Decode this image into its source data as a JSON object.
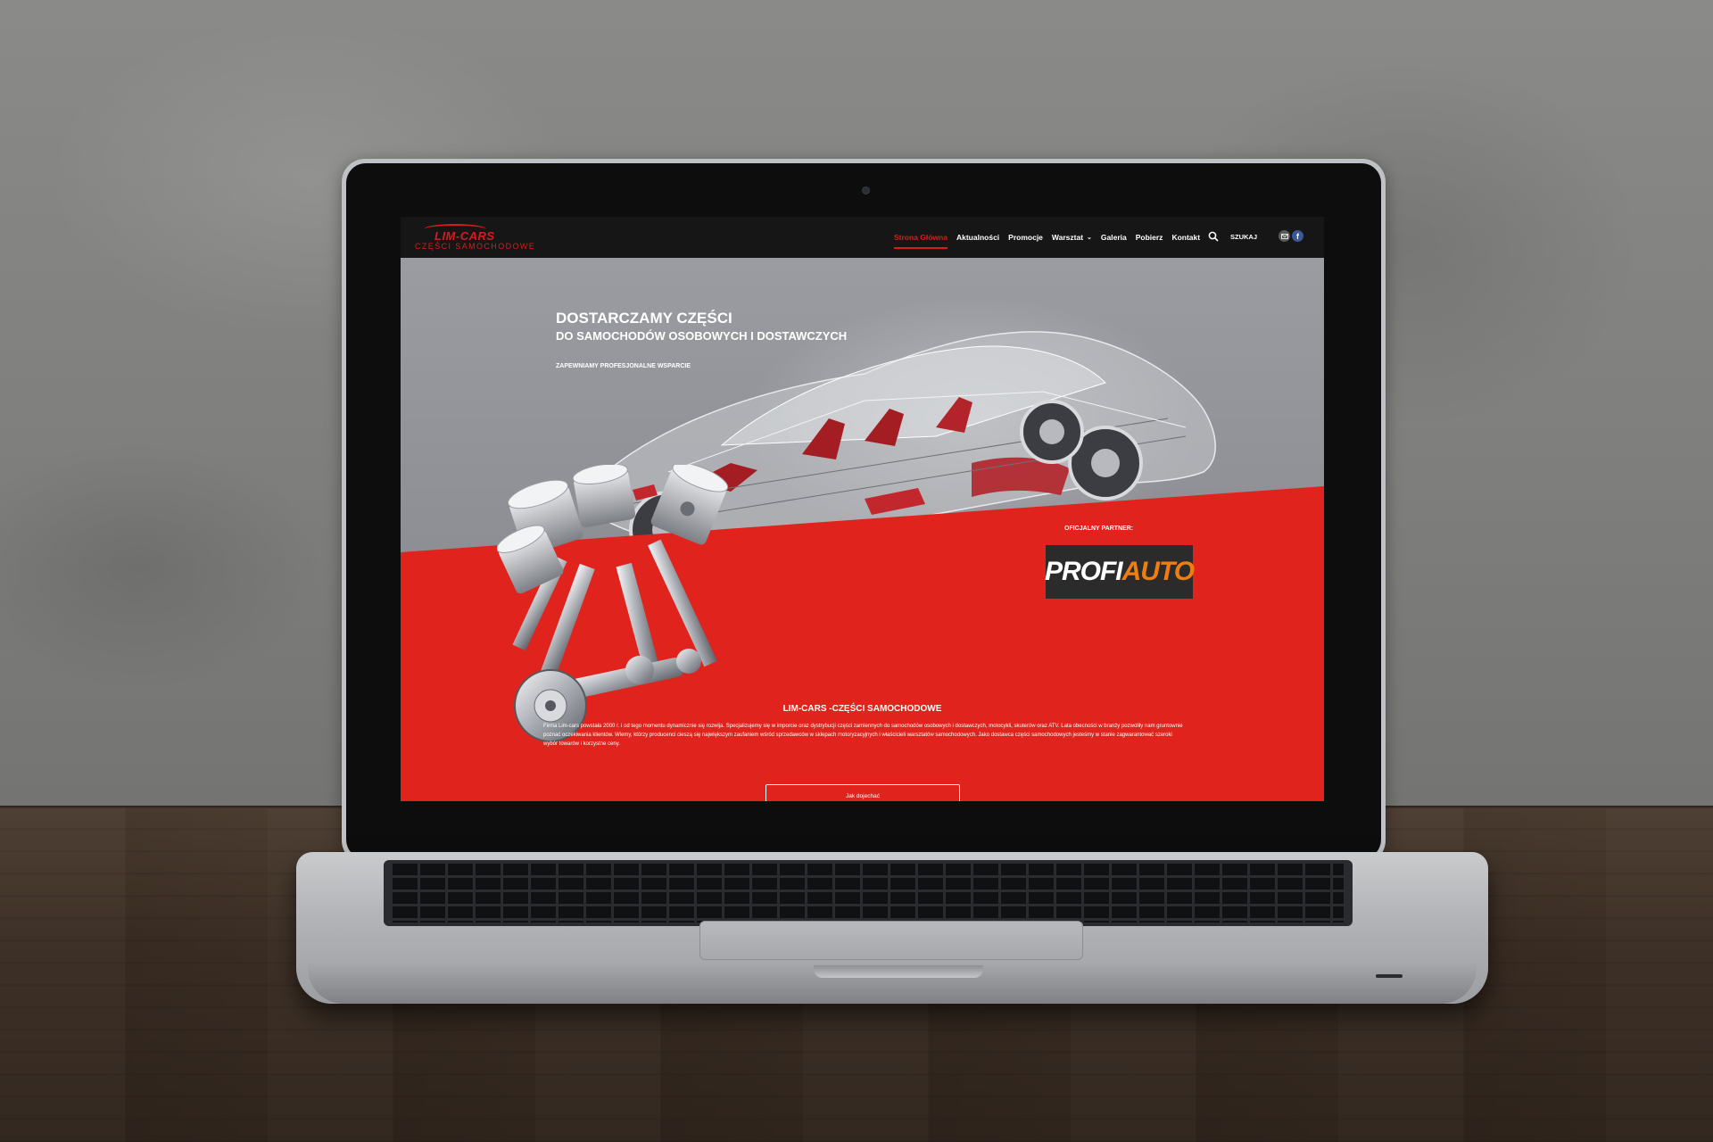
{
  "header": {
    "logo_name": "LIM-CARS",
    "logo_sub": "CZĘŚCI SAMOCHODOWE",
    "menu": [
      {
        "label": "Strona Główna",
        "active": true
      },
      {
        "label": "Aktualności",
        "active": false
      },
      {
        "label": "Promocje",
        "active": false
      },
      {
        "label": "Warsztat",
        "active": false,
        "has_dropdown": true
      },
      {
        "label": "Galeria",
        "active": false
      },
      {
        "label": "Pobierz",
        "active": false
      },
      {
        "label": "Kontakt",
        "active": false
      }
    ],
    "search_label": "SZUKAJ",
    "icons": [
      "search-icon",
      "mail-icon",
      "facebook-icon"
    ]
  },
  "hero": {
    "headline_1": "DOSTARCZAMY CZĘŚCI",
    "headline_2": "DO SAMOCHODÓW OSOBOWYCH I DOSTAWCZYCH",
    "headline_3": "ZAPEWNIAMY PROFESJONALNE WSPARCIE",
    "partner_label": "OFICJALNY PARTNER:",
    "partner_logo_a": "PROFI",
    "partner_logo_b": "AUTO"
  },
  "about": {
    "title": "LIM-CARS -CZĘŚCI SAMOCHODOWE",
    "text": "Firma Lim-cars powstała 2000 r. i od tego momentu dynamicznie się rozwija. Specjalizujemy się w imporcie oraz dystrybucji części zamiennych do samochodów osobowych i dostawczych, motocykli, skuterów oraz ATV. Lata obecności w branży pozwoliły nam gruntownie poznać oczekiwania klientów. Wiemy, którzy producenci cieszą się największym zaufaniem wśród sprzedawców w sklepach motoryzacyjnych i właścicieli warsztatów samochodowych. Jako dostawca części samochodowych jesteśmy w stanie zagwarantować szeroki wybór towarów i korzystne ceny.",
    "button_label": "Jak dojechać"
  },
  "colors": {
    "accent": "#d81c1c",
    "navbar": "#161616",
    "partner_orange": "#f07d10"
  }
}
